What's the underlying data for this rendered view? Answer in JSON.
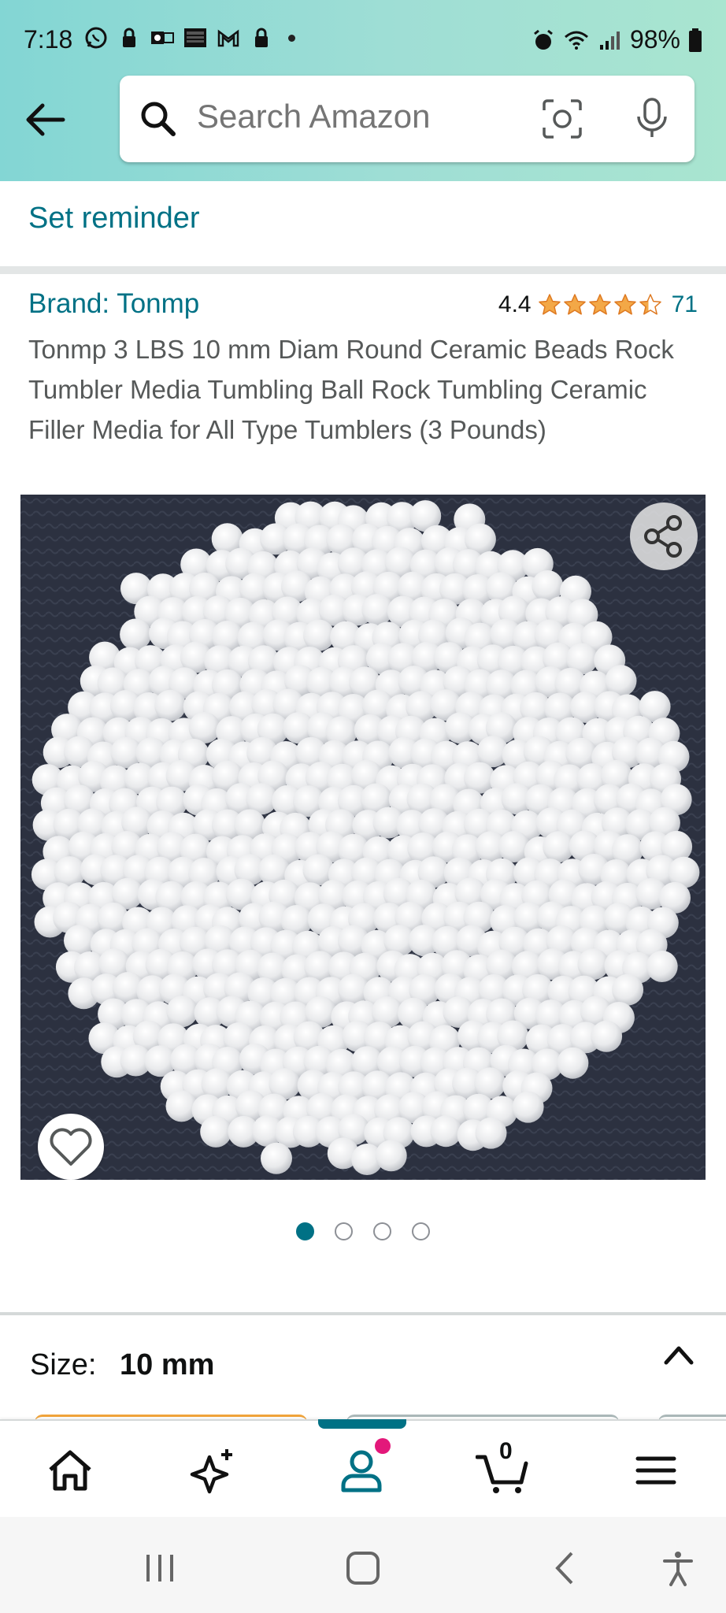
{
  "status_bar": {
    "time": "7:18",
    "battery": "98%"
  },
  "search": {
    "placeholder": "Search Amazon"
  },
  "reminder": {
    "label": "Set reminder"
  },
  "product": {
    "brand": "Brand: Tonmp",
    "rating": "4.4",
    "rating_stars": 4.4,
    "rating_count": "71",
    "title": "Tonmp 3 LBS 10 mm Diam Round Ceramic Beads Rock Tumbler Media Tumbling Ball Rock Tumbling Ceramic Filler Media for All Type Tumblers (3 Pounds)"
  },
  "gallery": {
    "image_count": 4,
    "active_index": 0
  },
  "size": {
    "label": "Size:",
    "value": "10 mm"
  },
  "bottom_nav": {
    "cart_count": "0",
    "items": [
      "home-icon",
      "ai-sparkle-icon",
      "account-icon",
      "cart-icon",
      "menu-icon"
    ]
  },
  "colors": {
    "accent": "#007185",
    "star": "#f3a847",
    "header_start": "#83d6d4",
    "header_end": "#a9e5d0"
  }
}
